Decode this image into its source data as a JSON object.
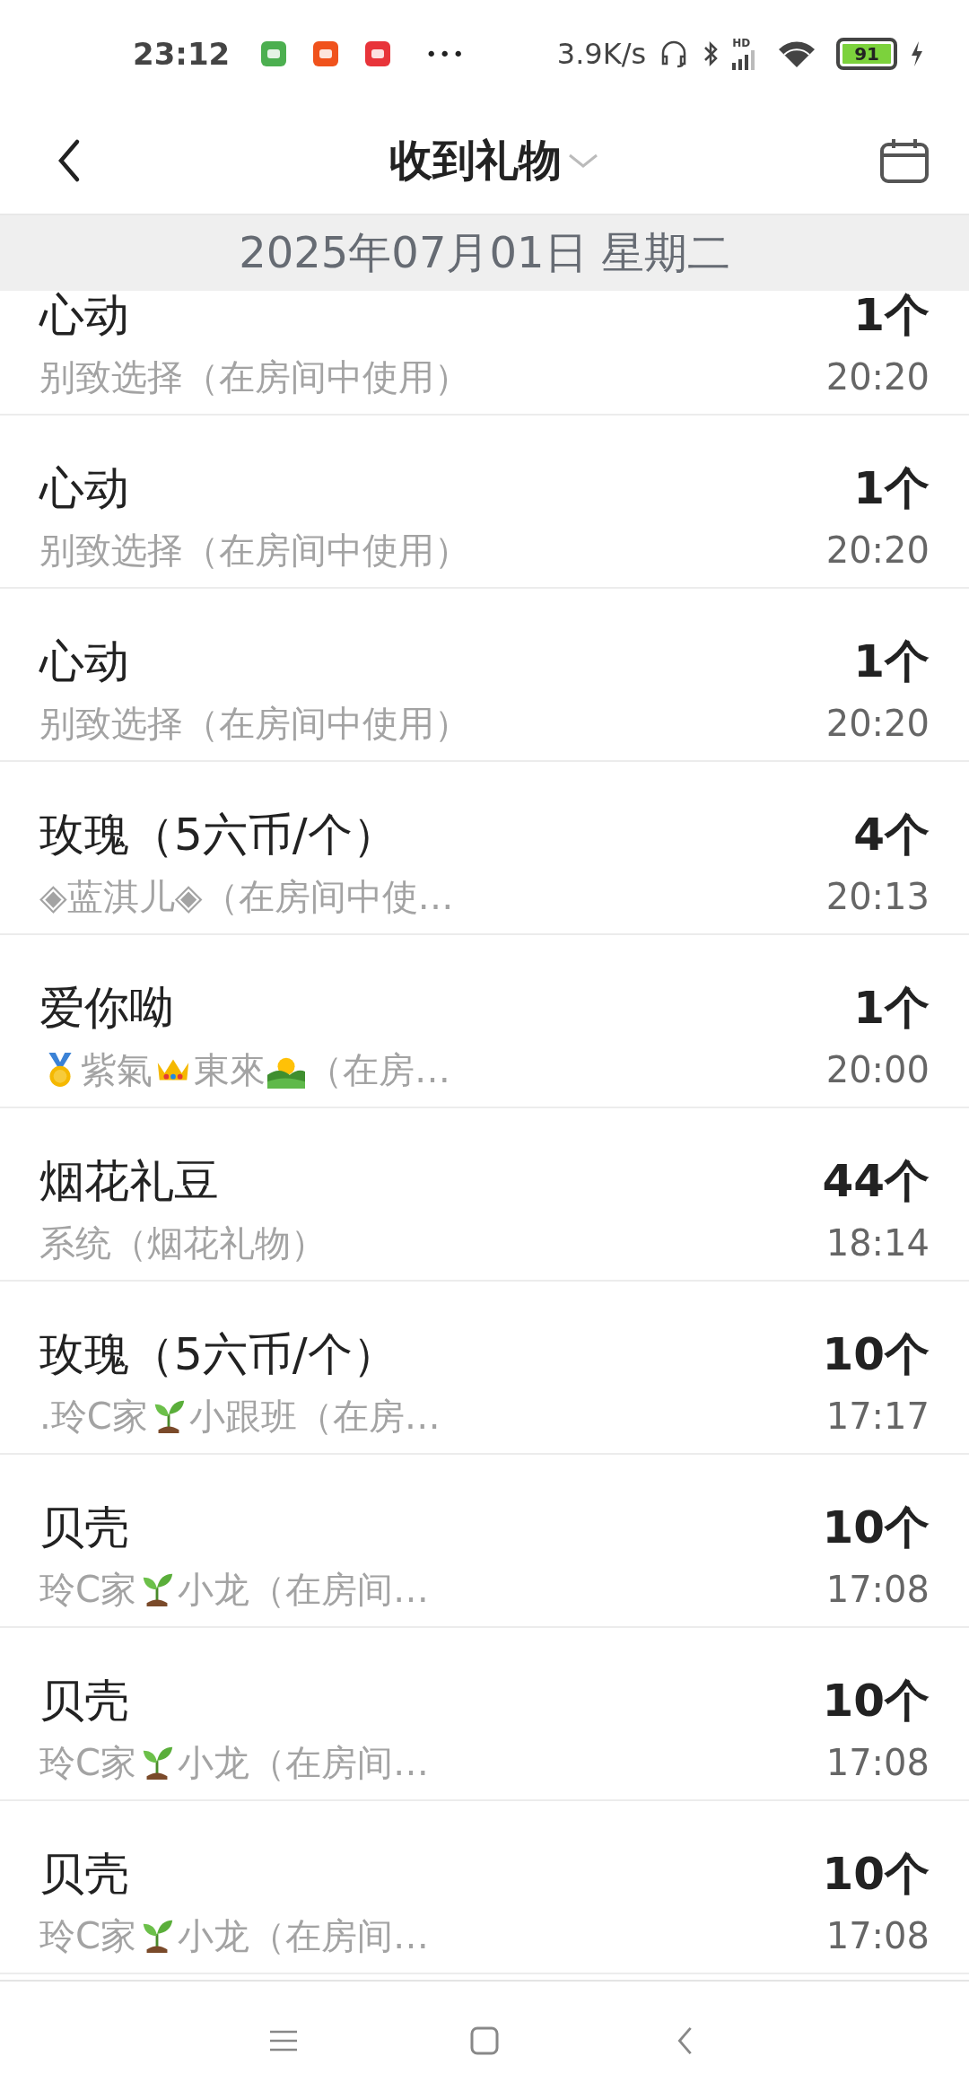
{
  "status_bar": {
    "time": "23:12",
    "notification_icons": [
      {
        "kind": "app-green"
      },
      {
        "kind": "app-orange"
      },
      {
        "kind": "app-red"
      }
    ],
    "more": "•••",
    "speed": "3.9K/s",
    "signal_label": "HD",
    "battery": "91",
    "charging": true
  },
  "header": {
    "title": "收到礼物"
  },
  "date_band": "2025年07月01日 星期二",
  "gifts": [
    {
      "name": "心动",
      "count": "1个",
      "time": "20:20",
      "from": [
        {
          "kind": "text",
          "text": "别致选择（在房间中使用）"
        }
      ]
    },
    {
      "name": "心动",
      "count": "1个",
      "time": "20:20",
      "from": [
        {
          "kind": "text",
          "text": "别致选择（在房间中使用）"
        }
      ]
    },
    {
      "name": "心动",
      "count": "1个",
      "time": "20:20",
      "from": [
        {
          "kind": "text",
          "text": "别致选择（在房间中使用）"
        }
      ]
    },
    {
      "name": "玫瑰（5六币/个）",
      "count": "4个",
      "time": "20:13",
      "from": [
        {
          "kind": "text",
          "text": "◈蓝淇儿◈（在房间中使…"
        }
      ]
    },
    {
      "name": "爱你呦",
      "count": "1个",
      "time": "20:00",
      "from": [
        {
          "kind": "medal"
        },
        {
          "kind": "text",
          "text": "紫氣"
        },
        {
          "kind": "crown"
        },
        {
          "kind": "text",
          "text": "東來"
        },
        {
          "kind": "sunrise"
        },
        {
          "kind": "text",
          "text": "（在房…"
        }
      ]
    },
    {
      "name": "烟花礼豆",
      "count": "44个",
      "time": "18:14",
      "from": [
        {
          "kind": "text",
          "text": "系统（烟花礼物）"
        }
      ]
    },
    {
      "name": "玫瑰（5六币/个）",
      "count": "10个",
      "time": "17:17",
      "from": [
        {
          "kind": "text",
          "text": ".玲C家"
        },
        {
          "kind": "sprout"
        },
        {
          "kind": "text",
          "text": "小跟班（在房…"
        }
      ]
    },
    {
      "name": "贝壳",
      "count": "10个",
      "time": "17:08",
      "from": [
        {
          "kind": "text",
          "text": "玲C家"
        },
        {
          "kind": "sprout"
        },
        {
          "kind": "text",
          "text": "小龙（在房间…"
        }
      ]
    },
    {
      "name": "贝壳",
      "count": "10个",
      "time": "17:08",
      "from": [
        {
          "kind": "text",
          "text": "玲C家"
        },
        {
          "kind": "sprout"
        },
        {
          "kind": "text",
          "text": "小龙（在房间…"
        }
      ]
    },
    {
      "name": "贝壳",
      "count": "10个",
      "time": "17:08",
      "from": [
        {
          "kind": "text",
          "text": "玲C家"
        },
        {
          "kind": "sprout"
        },
        {
          "kind": "text",
          "text": "小龙（在房间…"
        }
      ]
    }
  ]
}
